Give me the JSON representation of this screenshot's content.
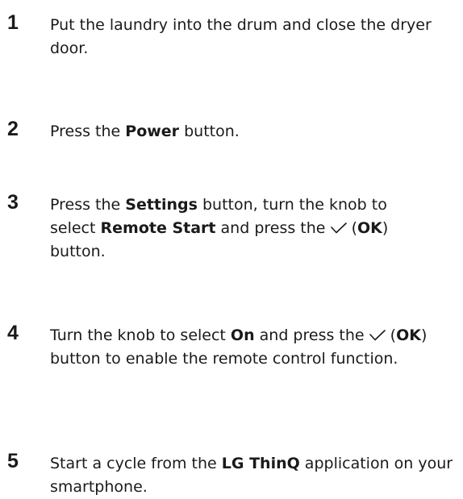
{
  "steps": [
    {
      "number": "1",
      "parts": [
        {
          "t": "Put the laundry into the drum and close the dryer door."
        }
      ]
    },
    {
      "number": "2",
      "parts": [
        {
          "t": "Press the "
        },
        {
          "b": "Power"
        },
        {
          "t": " button."
        }
      ]
    },
    {
      "number": "3",
      "parts": [
        {
          "t": "Press the "
        },
        {
          "b": "Settings"
        },
        {
          "t": " button, turn the knob to select "
        },
        {
          "b": "Remote Start"
        },
        {
          "t": " and press the "
        },
        {
          "icon": "checkmark-icon"
        },
        {
          "t": " ("
        },
        {
          "b": "OK"
        },
        {
          "t": ") button."
        }
      ]
    },
    {
      "number": "4",
      "parts": [
        {
          "t": "Turn the knob to select "
        },
        {
          "b": "On"
        },
        {
          "t": " and press the "
        },
        {
          "icon": "checkmark-icon"
        },
        {
          "t": " ("
        },
        {
          "b": "OK"
        },
        {
          "t": ") button to enable the remote control function."
        }
      ]
    },
    {
      "number": "5",
      "parts": [
        {
          "t": "Start a cycle from the "
        },
        {
          "b": "LG ThinQ"
        },
        {
          "t": " application on your smartphone."
        }
      ]
    }
  ]
}
